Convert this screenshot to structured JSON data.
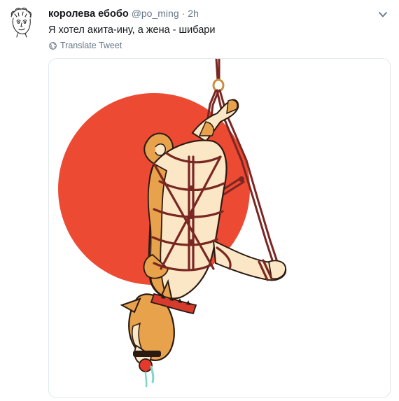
{
  "tweet": {
    "display_name": "королева ебобо",
    "handle": "@po_ming",
    "separator": "·",
    "time": "2h",
    "text": "Я хотел акита-ину, а жена - шибари",
    "translate_label": "Translate Tweet"
  },
  "icons": {
    "avatar": "sketched-face-avatar",
    "caret": "chevron-down-icon",
    "translate": "globe-icon"
  },
  "colors": {
    "text_primary": "#14171a",
    "text_secondary": "#657786",
    "media_border": "#e1e8ed",
    "sun_red": "#ec4a33",
    "rope": "#7a2622",
    "fur_orange": "#e8a24c",
    "fur_cream": "#fbe7c5"
  },
  "media": {
    "subject": "illustration of a shiba inu dog suspended upside down in red rope shibari in front of a red sun"
  }
}
